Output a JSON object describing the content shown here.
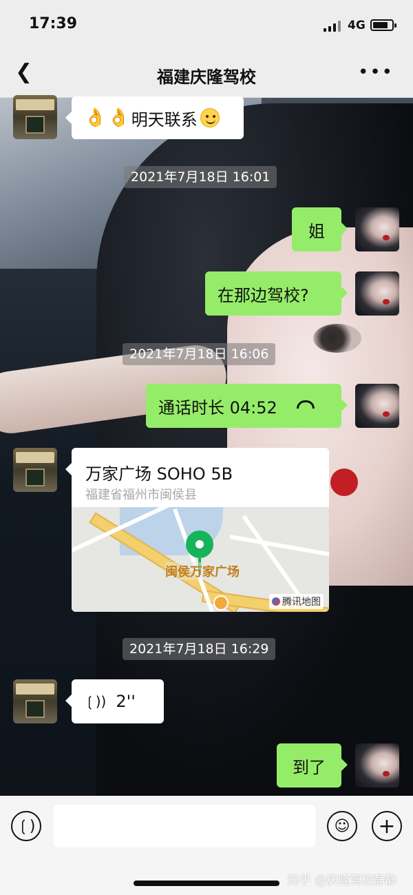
{
  "status_bar": {
    "time": "17:39",
    "network": "4G"
  },
  "header": {
    "title": "福建庆隆驾校",
    "back_icon": "chevron-left-icon",
    "more_icon": "ellipsis-icon"
  },
  "messages": {
    "m1_text": "明天联系",
    "ts1": "2021年7月18日 16:01",
    "m2_text": "姐",
    "m3_text": "在那边驾校?",
    "ts2": "2021年7月18日 16:06",
    "m4_text": "通话时长 04:52",
    "location": {
      "name": "万家广场 SOHO 5B",
      "address": "福建省福州市闽侯县",
      "map_label": "闽侯万家广场",
      "map_credit": "腾讯地图"
    },
    "ts3": "2021年7月18日 16:29",
    "voice_duration": "2''",
    "m6_text": "到了"
  },
  "input": {
    "placeholder": ""
  },
  "watermark": "知乎 @庆隆驾校静静",
  "colors": {
    "outgoing_bubble": "#95ec69",
    "incoming_bubble": "#ffffff",
    "bar_bg": "#ededed"
  }
}
